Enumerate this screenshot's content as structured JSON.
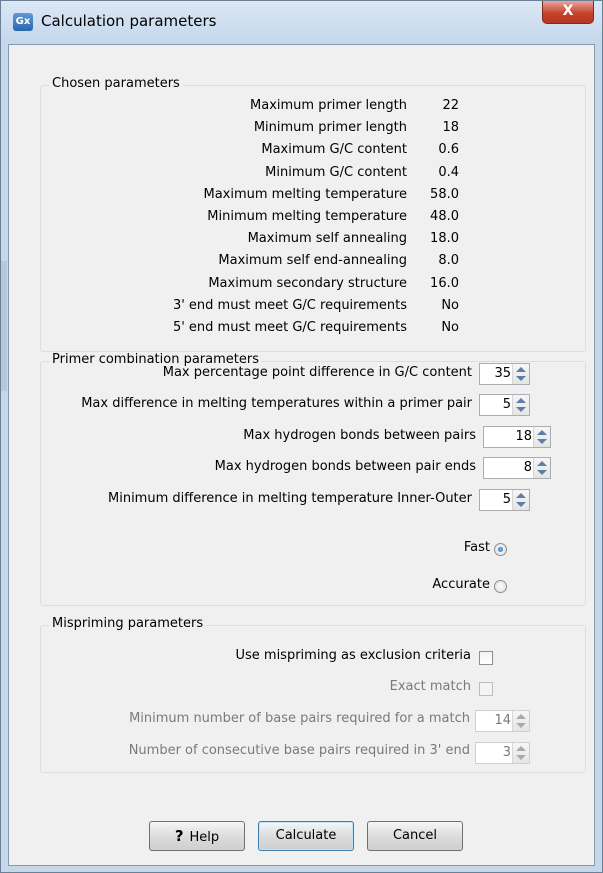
{
  "window": {
    "title": "Calculation parameters",
    "app_icon": "Gx",
    "close_glyph": "X"
  },
  "chosen": {
    "title": "Chosen parameters",
    "rows": [
      {
        "label": "Maximum primer length",
        "value": "22"
      },
      {
        "label": "Minimum primer length",
        "value": "18"
      },
      {
        "label": "Maximum G/C content",
        "value": "0.6"
      },
      {
        "label": "Minimum G/C content",
        "value": "0.4"
      },
      {
        "label": "Maximum melting temperature",
        "value": "58.0"
      },
      {
        "label": "Minimum melting temperature",
        "value": "48.0"
      },
      {
        "label": "Maximum self annealing",
        "value": "18.0"
      },
      {
        "label": "Maximum self end-annealing",
        "value": "8.0"
      },
      {
        "label": "Maximum secondary structure",
        "value": "16.0"
      },
      {
        "label": "3' end must meet G/C requirements",
        "value": "No"
      },
      {
        "label": "5' end must meet G/C requirements",
        "value": "No"
      }
    ]
  },
  "combo": {
    "title": "Primer combination parameters",
    "rows": [
      {
        "label": "Max percentage point difference in G/C content",
        "value": "35"
      },
      {
        "label": "Max difference in melting temperatures within a primer pair",
        "value": "5"
      },
      {
        "label": "Max hydrogen bonds between pairs",
        "value": "18"
      },
      {
        "label": "Max hydrogen bonds between pair ends",
        "value": "8"
      },
      {
        "label": "Minimum difference in melting temperature Inner-Outer",
        "value": "5"
      }
    ],
    "fast_label": "Fast",
    "accurate_label": "Accurate",
    "selected": "Fast"
  },
  "mispriming": {
    "title": "Mispriming parameters",
    "use_label": "Use mispriming as exclusion criteria",
    "exact_label": "Exact match",
    "min_bp_label": "Minimum number of base pairs required for a match",
    "min_bp_value": "14",
    "consec_label": "Number of consecutive base pairs required in 3' end",
    "consec_value": "3"
  },
  "buttons": {
    "help_icon": "?",
    "help": "Help",
    "calculate": "Calculate",
    "cancel": "Cancel"
  }
}
